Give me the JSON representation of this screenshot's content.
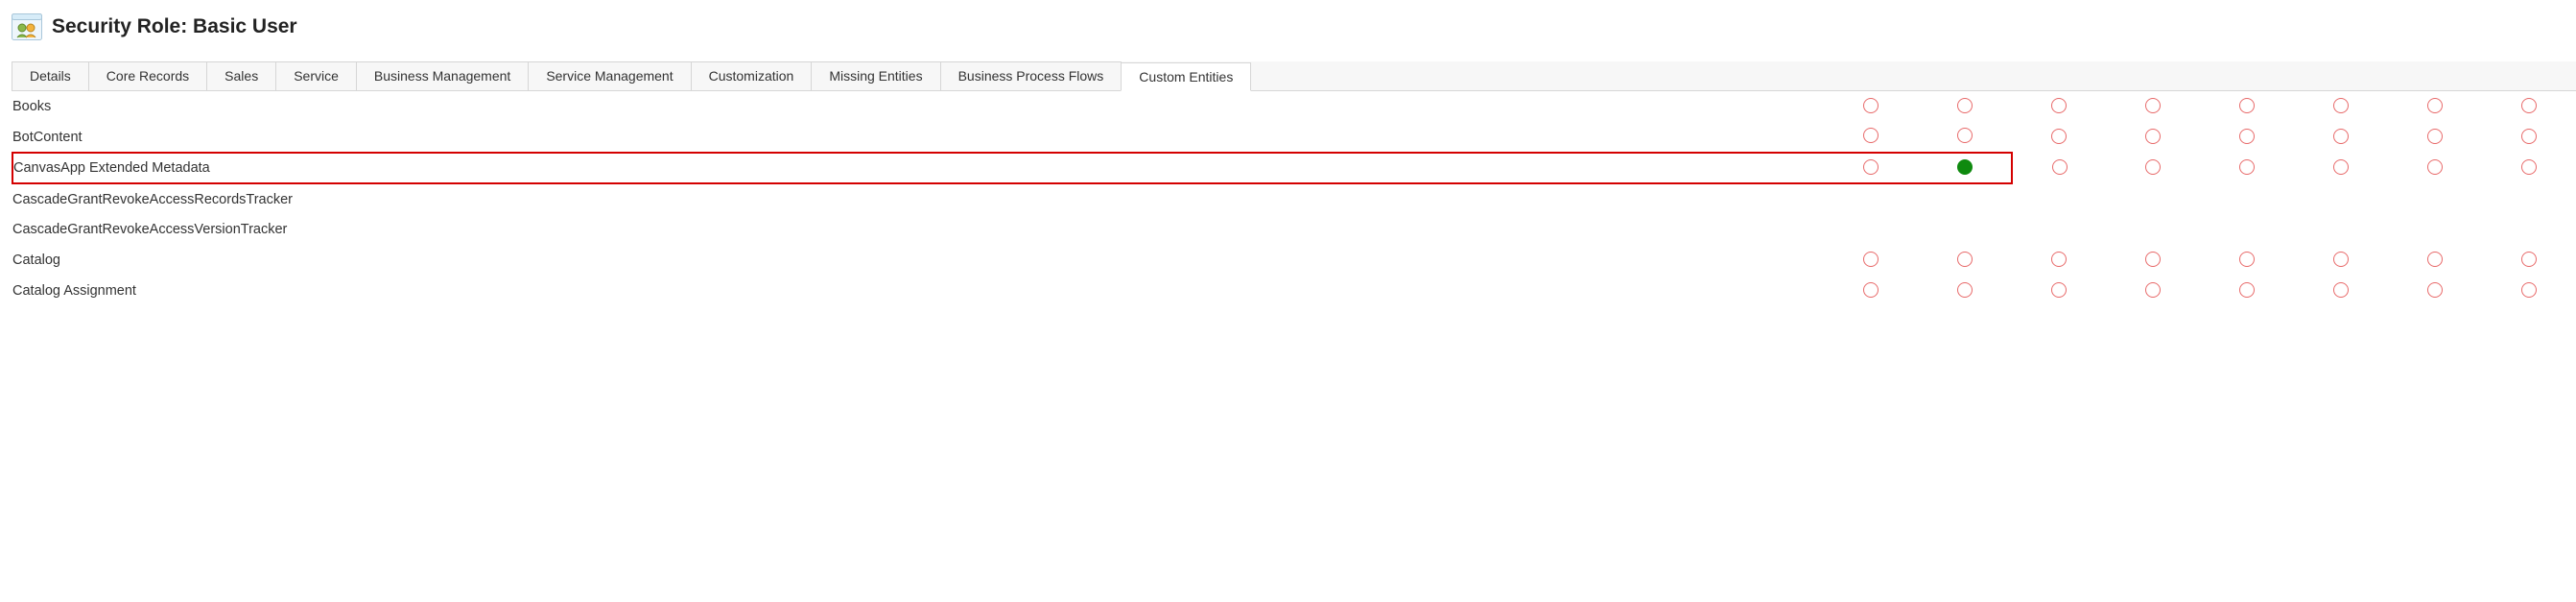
{
  "header": {
    "title": "Security Role: Basic User"
  },
  "tabs": {
    "items": [
      "Details",
      "Core Records",
      "Sales",
      "Service",
      "Business Management",
      "Service Management",
      "Customization",
      "Missing Entities",
      "Business Process Flows",
      "Custom Entities"
    ],
    "active_index": 9
  },
  "colors": {
    "empty_border": "#e86a6a",
    "full_fill": "#0f8a0f",
    "highlight_border": "#d40000"
  },
  "grid": {
    "priv_columns": 8,
    "highlight_row_index": 2,
    "highlight_col_span": 2,
    "rows": [
      {
        "name": "Books",
        "privs": [
          "none",
          "none",
          "none",
          "none",
          "none",
          "none",
          "none",
          "none"
        ]
      },
      {
        "name": "BotContent",
        "privs": [
          "none",
          "none",
          "none",
          "none",
          "none",
          "none",
          "none",
          "none"
        ]
      },
      {
        "name": "CanvasApp Extended Metadata",
        "privs": [
          "none",
          "full",
          "none",
          "none",
          "none",
          "none",
          "none",
          "none"
        ]
      },
      {
        "name": "CascadeGrantRevokeAccessRecordsTracker",
        "privs": []
      },
      {
        "name": "CascadeGrantRevokeAccessVersionTracker",
        "privs": []
      },
      {
        "name": "Catalog",
        "privs": [
          "none",
          "none",
          "none",
          "none",
          "none",
          "none",
          "none",
          "none"
        ]
      },
      {
        "name": "Catalog Assignment",
        "privs": [
          "none",
          "none",
          "none",
          "none",
          "none",
          "none",
          "none",
          "none"
        ]
      }
    ]
  }
}
